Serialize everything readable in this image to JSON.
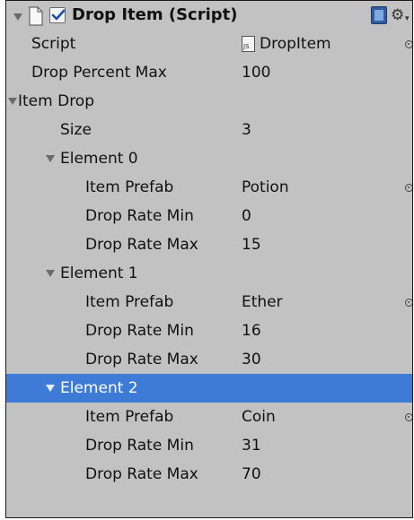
{
  "component": {
    "title": "Drop Item (Script)",
    "enabled": true
  },
  "icons": {
    "foldout": "triangle-down-icon",
    "document": "document-icon",
    "help": "help-book-icon",
    "settings": "gear-icon",
    "object_picker": "object-picker-icon",
    "script_asset": "js-script-icon",
    "script_asset_text": "JS"
  },
  "properties": {
    "script": {
      "label": "Script",
      "value": "DropItem"
    },
    "drop_percent_max": {
      "label": "Drop Percent Max",
      "value": "100"
    },
    "item_drop": {
      "label": "Item Drop",
      "size_label": "Size",
      "size_value": "3",
      "elements": [
        {
          "label": "Element 0",
          "item_prefab": {
            "label": "Item Prefab",
            "value": "Potion"
          },
          "drop_rate_min": {
            "label": "Drop Rate Min",
            "value": "0"
          },
          "drop_rate_max": {
            "label": "Drop Rate Max",
            "value": "15"
          }
        },
        {
          "label": "Element 1",
          "item_prefab": {
            "label": "Item Prefab",
            "value": "Ether"
          },
          "drop_rate_min": {
            "label": "Drop Rate Min",
            "value": "16"
          },
          "drop_rate_max": {
            "label": "Drop Rate Max",
            "value": "30"
          }
        },
        {
          "label": "Element 2",
          "selected": true,
          "item_prefab": {
            "label": "Item Prefab",
            "value": "Coin"
          },
          "drop_rate_min": {
            "label": "Drop Rate Min",
            "value": "31"
          },
          "drop_rate_max": {
            "label": "Drop Rate Max",
            "value": "70"
          }
        }
      ]
    }
  },
  "colors": {
    "panel_background": "#c2c2c2",
    "selection": "#3d7bd6",
    "text": "#111111"
  }
}
